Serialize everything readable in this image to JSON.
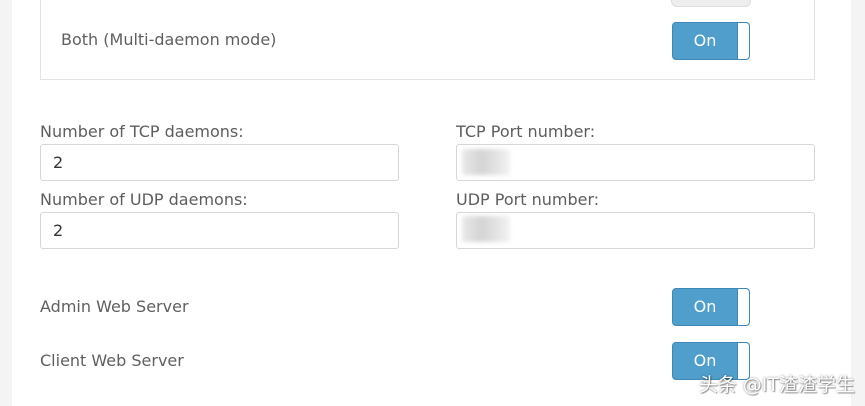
{
  "mode_panel": {
    "multi_daemon_label": "Both (Multi-daemon mode)",
    "multi_daemon_toggle": "On"
  },
  "fields": {
    "tcp_daemons_label": "Number of TCP daemons:",
    "tcp_daemons_value": "2",
    "tcp_port_label": "TCP Port number:",
    "tcp_port_value": "",
    "udp_daemons_label": "Number of UDP daemons:",
    "udp_daemons_value": "2",
    "udp_port_label": "UDP Port number:",
    "udp_port_value": ""
  },
  "servers": {
    "admin_web_label": "Admin Web Server",
    "admin_web_toggle": "On",
    "client_web_label": "Client Web Server",
    "client_web_toggle": "On"
  },
  "watermark": "头条 @IT渣渣学生",
  "colors": {
    "toggle_on": "#4f9ecb",
    "toggle_border": "#3d88b8",
    "page_background": "#ffffff",
    "side_band": "#f4f4f4"
  }
}
